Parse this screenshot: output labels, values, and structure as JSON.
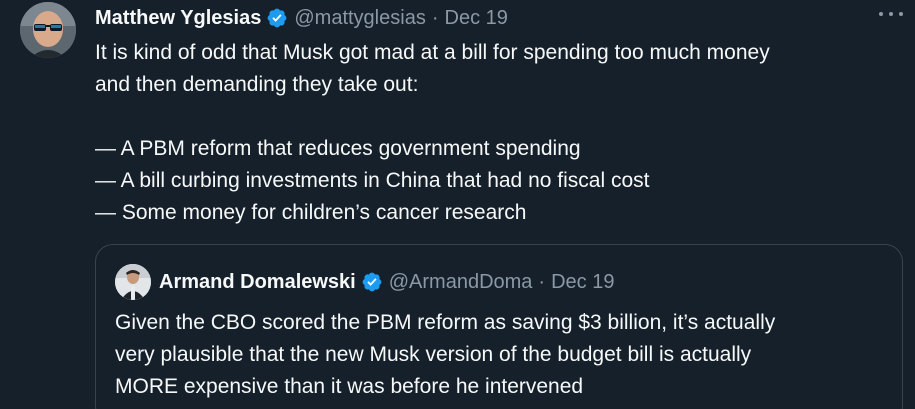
{
  "tweet": {
    "author": {
      "display_name": "Matthew Yglesias",
      "handle": "@mattyglesias",
      "verified": true
    },
    "separator": "·",
    "date": "Dec 19",
    "text_lines": [
      "It is kind of odd that Musk got mad at a bill for spending too much money",
      "and then demanding they take out:",
      "",
      "— A PBM reform that reduces government spending",
      "— A bill curbing investments in China that had no fiscal cost",
      "— Some money for children’s cancer research"
    ]
  },
  "quoted_tweet": {
    "author": {
      "display_name": "Armand Domalewski",
      "handle": "@ArmandDoma",
      "verified": true
    },
    "separator": "·",
    "date": "Dec 19",
    "text_lines": [
      "Given the CBO scored the PBM reform as saving $3 billion, it’s actually",
      "very plausible that the new Musk version of the budget bill is actually",
      "MORE expensive than it was before he intervened"
    ]
  },
  "colors": {
    "background": "#15202b",
    "primary_text": "#f7f9f9",
    "secondary_text": "#8b98a5",
    "verified_badge": "#1d9bf0",
    "quote_border": "#38444d"
  },
  "icons": {
    "verified": "verified-badge-icon",
    "more": "more-options-icon"
  }
}
